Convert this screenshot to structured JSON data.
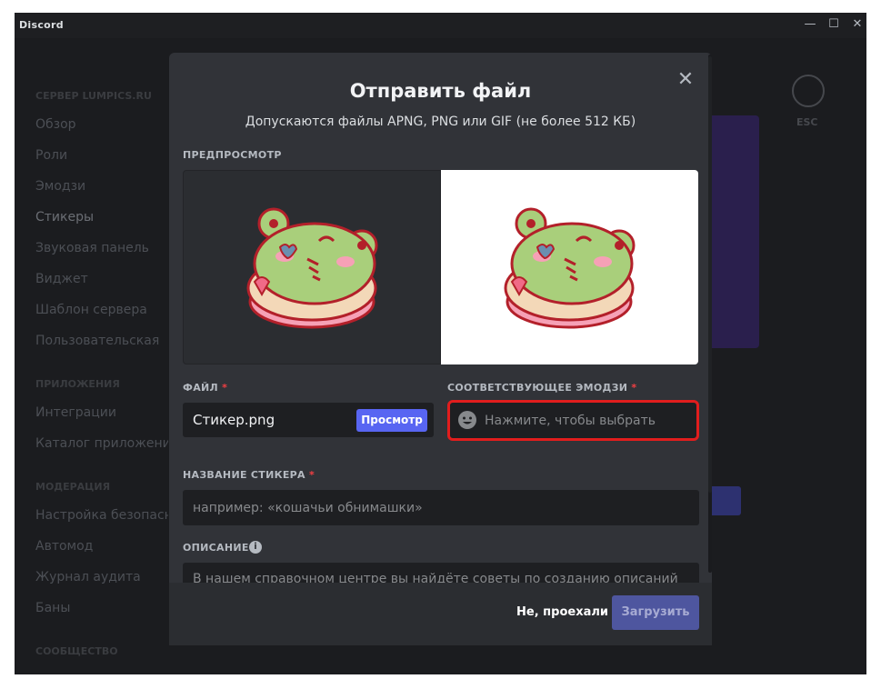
{
  "window": {
    "title": "Discord",
    "minimize": "—",
    "maximize": "☐",
    "close": "✕"
  },
  "background": {
    "categories": [
      "Сервер Lumpics.ru",
      "Приложения",
      "Модерация",
      "Сообщество"
    ],
    "nav_items": [
      "Обзор",
      "Роли",
      "Эмодзи",
      "Стикеры",
      "Звуковая панель",
      "Виджет",
      "Шаблон сервера",
      "Пользовательская",
      "Интеграции",
      "Каталог приложений",
      "Настройка безопасности",
      "Автомод",
      "Журнал аудита",
      "Баны"
    ],
    "esc_label": "ESC"
  },
  "modal": {
    "title": "Отправить файл",
    "subtitle": "Допускаются файлы APNG, PNG или GIF (не более 512 КБ)",
    "preview_label": "ПРЕДПРОСМОТР",
    "file_label": "ФАЙЛ",
    "required_mark": "*",
    "file_name": "Стикер.png",
    "browse_label": "Просмотр",
    "emoji_label": "СООТВЕТСТВУЮЩЕЕ ЭМОДЗИ",
    "emoji_placeholder": "Нажмите, чтобы выбрать",
    "sticker_name_label": "НАЗВАНИЕ СТИКЕРА",
    "sticker_name_placeholder": "например: «кошачьи обнимашки»",
    "description_label": "ОПИСАНИЕ",
    "info_glyph": "i",
    "description_placeholder": "В нашем справочном центре вы найдёте советы по созданию описаний",
    "cancel_label": "Не, проехали",
    "upload_label": "Загрузить",
    "close_glyph": "✕"
  },
  "colors": {
    "accent": "#5865f2",
    "highlight": "#e11d1d",
    "sticker_green": "#a9cf7b",
    "sticker_outline": "#b3202a",
    "sticker_pink": "#f6a1b6"
  }
}
